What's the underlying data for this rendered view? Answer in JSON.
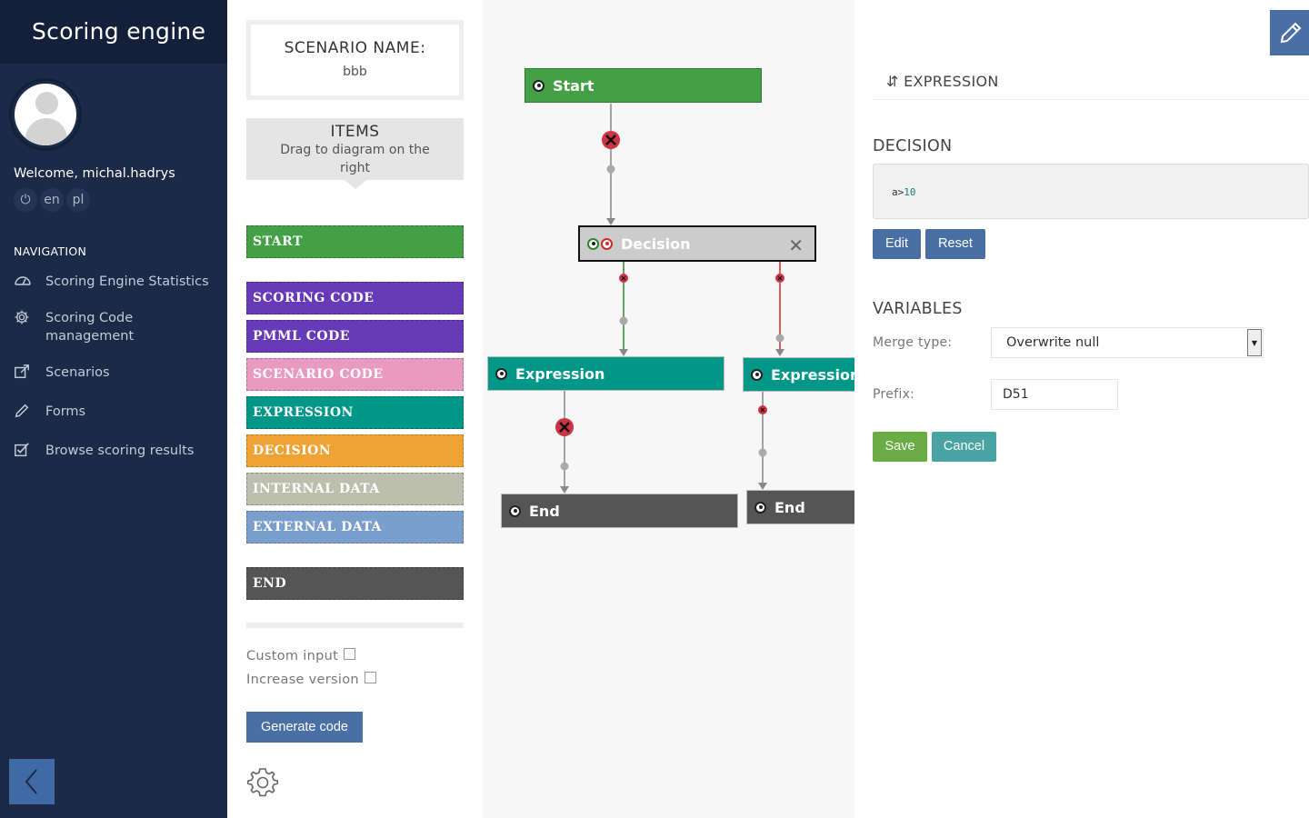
{
  "app": {
    "title": "Scoring engine"
  },
  "user": {
    "welcome": "Welcome, michal.hadrys",
    "controls": [
      "⏻",
      "en",
      "pl"
    ]
  },
  "navigation": {
    "title": "NAVIGATION",
    "items": [
      {
        "label": "Scoring Engine Statistics",
        "icon": "dashboard-icon"
      },
      {
        "label": "Scoring Code management",
        "icon": "gear-icon"
      },
      {
        "label": "Scenarios",
        "icon": "external-link-icon"
      },
      {
        "label": "Forms",
        "icon": "pencil-icon"
      },
      {
        "label": "Browse scoring results",
        "icon": "checkbox-icon"
      }
    ]
  },
  "scenario": {
    "label": "SCENARIO NAME:",
    "value": "bbb"
  },
  "items_panel": {
    "title": "ITEMS",
    "subtitle": "Drag to diagram on the right"
  },
  "palette": [
    {
      "label": "START",
      "color": "#43a047"
    },
    {
      "label": "SCORING CODE",
      "color": "#673ab7"
    },
    {
      "label": "PMML CODE",
      "color": "#673ab7"
    },
    {
      "label": "SCENARIO CODE",
      "color": "#e99ac1"
    },
    {
      "label": "EXPRESSION",
      "color": "#009688"
    },
    {
      "label": "DECISION",
      "color": "#f0a232"
    },
    {
      "label": "INTERNAL DATA",
      "color": "#bcbfae"
    },
    {
      "label": "EXTERNAL DATA",
      "color": "#7a9fcc"
    },
    {
      "label": "END",
      "color": "#555555"
    }
  ],
  "options": {
    "custom_input": "Custom input",
    "increase_version": "Increase version"
  },
  "generate_label": "Generate code",
  "diagram": {
    "nodes": {
      "start": "Start",
      "decision": "Decision",
      "expression_left": "Expression",
      "expression_right": "Expression",
      "end_left": "End",
      "end_right": "End"
    },
    "colors": {
      "start": "#43a047",
      "decision": "#cccccc",
      "expression": "#009688",
      "end": "#555555",
      "true_link": "#2c8a2c",
      "false_link": "#cc2b2b"
    }
  },
  "panel": {
    "title": "EXPRESSION",
    "decision": {
      "title": "DECISION",
      "code_var": "a",
      "code_op": ">",
      "code_num": "10",
      "edit": "Edit",
      "reset": "Reset"
    },
    "variables": {
      "title": "VARIABLES",
      "merge_label": "Merge type:",
      "merge_value": "Overwrite null",
      "prefix_label": "Prefix:",
      "prefix_value": "D51",
      "save": "Save",
      "cancel": "Cancel"
    }
  }
}
